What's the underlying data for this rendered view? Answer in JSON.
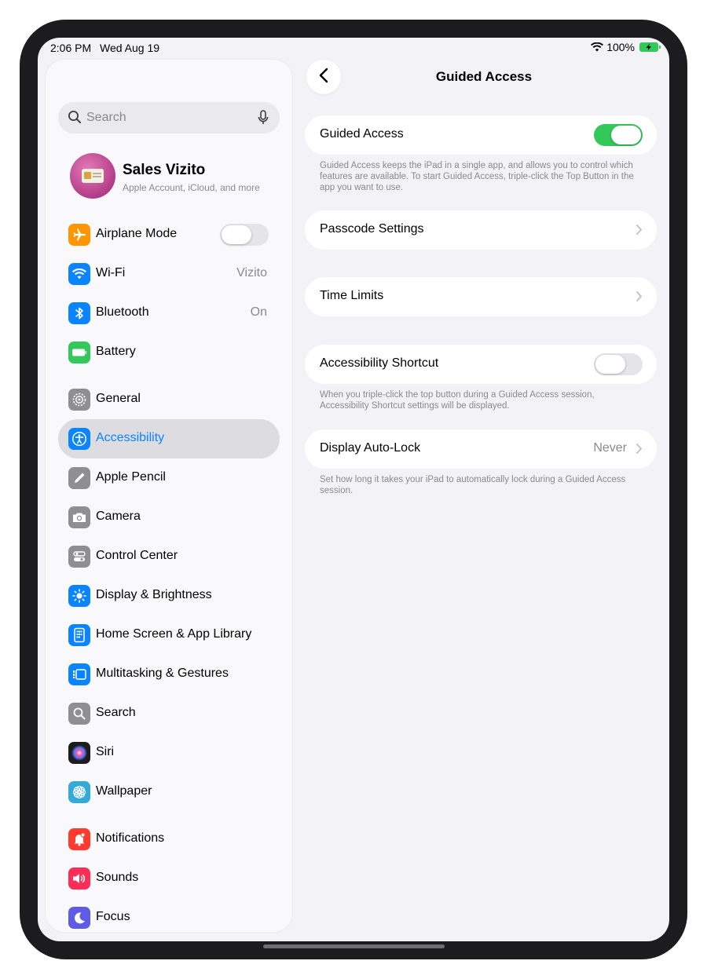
{
  "status_bar": {
    "time": "2:06 PM",
    "date": "Wed Aug 19",
    "battery": "100%"
  },
  "search": {
    "placeholder": "Search"
  },
  "profile": {
    "name": "Sales Vizito",
    "subtitle": "Apple Account, iCloud, and more"
  },
  "sidebar": {
    "items": [
      {
        "label": "Airplane Mode",
        "icon": "airplane-icon",
        "color": "#ff9500",
        "toggle": false
      },
      {
        "label": "Wi-Fi",
        "icon": "wifi-icon",
        "color": "#0a84ff",
        "value": "Vizito"
      },
      {
        "label": "Bluetooth",
        "icon": "bluetooth-icon",
        "color": "#0a84ff",
        "value": "On"
      },
      {
        "label": "Battery",
        "icon": "battery-icon",
        "color": "#34c759"
      },
      {
        "label": "General",
        "icon": "gear-icon",
        "color": "#8e8e93"
      },
      {
        "label": "Accessibility",
        "icon": "accessibility-icon",
        "color": "#0a84ff",
        "selected": true
      },
      {
        "label": "Apple Pencil",
        "icon": "pencil-icon",
        "color": "#8e8e93"
      },
      {
        "label": "Camera",
        "icon": "camera-icon",
        "color": "#8e8e93"
      },
      {
        "label": "Control Center",
        "icon": "control-center-icon",
        "color": "#8e8e93"
      },
      {
        "label": "Display & Brightness",
        "icon": "sun-icon",
        "color": "#0a84ff"
      },
      {
        "label": "Home Screen & App Library",
        "icon": "home-screen-icon",
        "color": "#0a84ff"
      },
      {
        "label": "Multitasking & Gestures",
        "icon": "multitasking-icon",
        "color": "#0a84ff"
      },
      {
        "label": "Search",
        "icon": "search-icon",
        "color": "#8e8e93"
      },
      {
        "label": "Siri",
        "icon": "siri-icon",
        "color": "#1c1c1e"
      },
      {
        "label": "Wallpaper",
        "icon": "flower-icon",
        "color": "#34aadc"
      },
      {
        "label": "Notifications",
        "icon": "bell-icon",
        "color": "#ff3b30"
      },
      {
        "label": "Sounds",
        "icon": "speaker-icon",
        "color": "#ff2d55"
      },
      {
        "label": "Focus",
        "icon": "moon-icon",
        "color": "#5e5ce6"
      }
    ]
  },
  "detail": {
    "title": "Guided Access",
    "guided_access": {
      "label": "Guided Access",
      "enabled": true,
      "footnote": "Guided Access keeps the iPad in a single app, and allows you to control which features are available. To start Guided Access, triple-click the Top Button in the app you want to use."
    },
    "passcode_settings": {
      "label": "Passcode Settings"
    },
    "time_limits": {
      "label": "Time Limits"
    },
    "accessibility_shortcut": {
      "label": "Accessibility Shortcut",
      "enabled": false,
      "footnote": "When you triple-click the top button during a Guided Access session, Accessibility Shortcut settings will be displayed."
    },
    "display_auto_lock": {
      "label": "Display Auto-Lock",
      "value": "Never",
      "footnote": "Set how long it takes your iPad to automatically lock during a Guided Access session."
    }
  },
  "colors": {
    "accent": "#0a84ff",
    "toggle_on": "#34c759",
    "background": "#f2f2f7"
  }
}
